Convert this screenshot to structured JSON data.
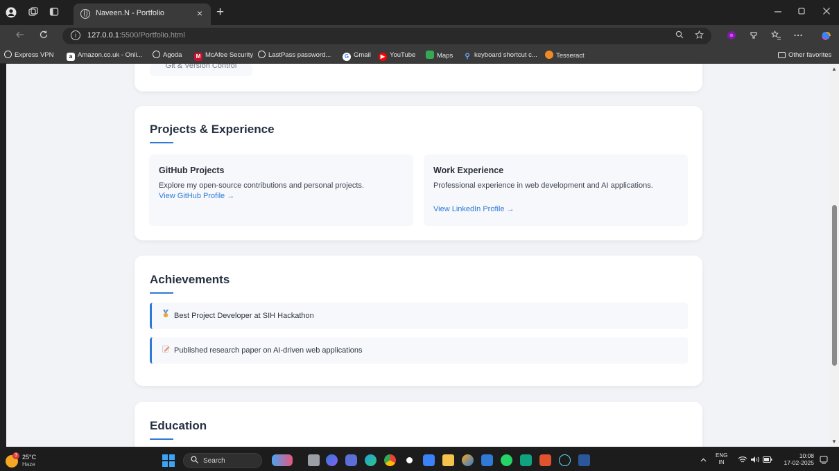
{
  "browser": {
    "tab_title": "Naveen.N - Portfolio",
    "tab_close": "×",
    "new_tab": "+",
    "url_host": "127.0.0.1",
    "url_rest": ":5500/Portfolio.html",
    "bookmarks": [
      {
        "label": "Express VPN",
        "icon": "globe-icon",
        "color": "#3a3a3a"
      },
      {
        "label": "Amazon.co.uk - Onli...",
        "icon": "amazon-icon",
        "color": "#ffffff"
      },
      {
        "label": "Agoda",
        "icon": "globe-icon",
        "color": "#3a3a3a"
      },
      {
        "label": "McAfee Security",
        "icon": "mcafee-icon",
        "color": "#c8102e"
      },
      {
        "label": "LastPass password...",
        "icon": "globe-icon",
        "color": "#3a3a3a"
      },
      {
        "label": "Gmail",
        "icon": "google-icon",
        "color": "#ffffff"
      },
      {
        "label": "YouTube",
        "icon": "youtube-icon",
        "color": "#ff0000"
      },
      {
        "label": "Maps",
        "icon": "maps-icon",
        "color": "#34a853"
      },
      {
        "label": "keyboard shortcut c...",
        "icon": "search-icon",
        "color": "#3a3a3a"
      },
      {
        "label": "Tesseract",
        "icon": "tesseract-icon",
        "color": "#f08a24"
      }
    ],
    "other_favorites": "Other favorites"
  },
  "page": {
    "skills_tail_chip": "Git & Version Control",
    "projects": {
      "title": "Projects & Experience",
      "cards": [
        {
          "heading": "GitHub Projects",
          "text": "Explore my open-source contributions and personal projects.",
          "link": "View GitHub Profile →"
        },
        {
          "heading": "Work Experience",
          "text": "Professional experience in web development and AI applications.",
          "link": "View LinkedIn Profile →"
        }
      ]
    },
    "achievements": {
      "title": "Achievements",
      "items": [
        {
          "emoji": "🏅",
          "text": "Best Project Developer at SIH Hackathon"
        },
        {
          "emoji": "📝",
          "text": "Published research paper on AI-driven web applications"
        }
      ]
    },
    "education": {
      "title": "Education"
    }
  },
  "taskbar": {
    "weather_temp": "25°C",
    "weather_condition": "Haze",
    "weather_badge": "3",
    "search_label": "Search",
    "lang_top": "ENG",
    "lang_bottom": "IN",
    "time": "10:08",
    "date": "17-02-2025"
  },
  "colors": {
    "accent": "#2f7ad6",
    "page_bg": "#f1f3f6",
    "card_bg": "#ffffff"
  }
}
